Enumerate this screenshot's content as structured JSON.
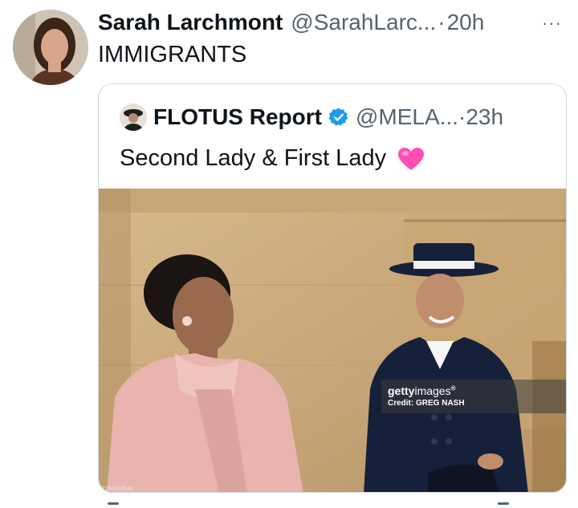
{
  "tweet": {
    "author_name": "Sarah Larchmont",
    "author_handle": "@SarahLarc...",
    "separator": "·",
    "time": "20h",
    "more": "···",
    "text": "IMMIGRANTS"
  },
  "quote": {
    "author_name": "FLOTUS Report",
    "author_handle": "@MELA...",
    "separator": "·",
    "time": "23h",
    "text": "Second Lady & First Lady",
    "verified": true,
    "emoji": "pink-heart"
  },
  "photo": {
    "watermark_logo_bold": "getty",
    "watermark_logo_regular": "images",
    "watermark_mark": "®",
    "watermark_credit": "Credit: GREG NASH",
    "id_text": "2194420546"
  },
  "colors": {
    "text_primary": "#0f1419",
    "text_secondary": "#536471",
    "border": "#cfd9de",
    "verified_blue": "#1d9bf0",
    "heart_pink": "#ff4fb4"
  }
}
